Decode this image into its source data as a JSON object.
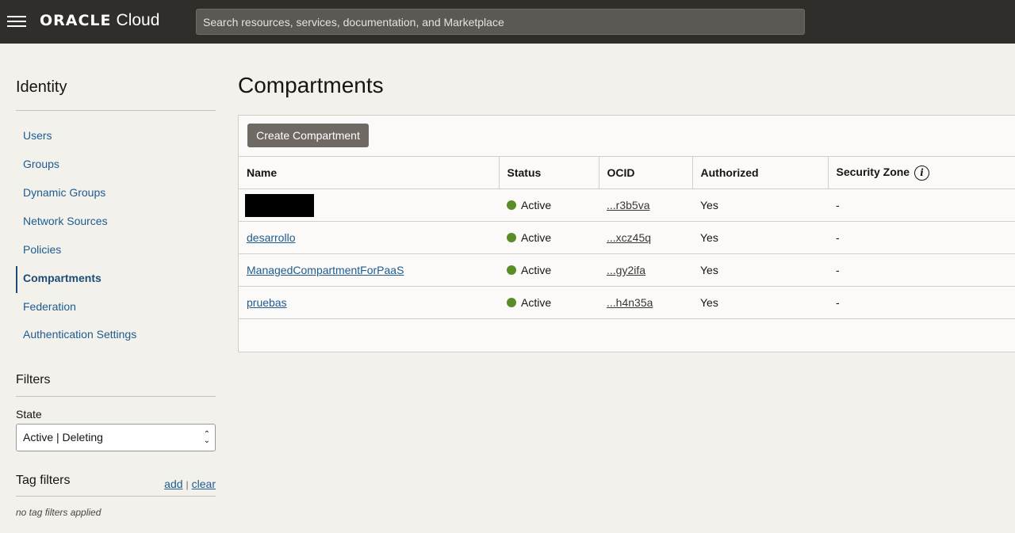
{
  "topbar": {
    "brand": "ORACLE",
    "product": "Cloud",
    "search_placeholder": "Search resources, services, documentation, and Marketplace"
  },
  "sidebar": {
    "title": "Identity",
    "items": [
      {
        "label": "Users"
      },
      {
        "label": "Groups"
      },
      {
        "label": "Dynamic Groups"
      },
      {
        "label": "Network Sources"
      },
      {
        "label": "Policies"
      },
      {
        "label": "Compartments",
        "active": true
      },
      {
        "label": "Federation"
      },
      {
        "label": "Authentication Settings"
      }
    ],
    "filters_title": "Filters",
    "state_label": "State",
    "state_value": "Active | Deleting",
    "tag_filters_title": "Tag filters",
    "tag_add": "add",
    "tag_sep": "|",
    "tag_clear": "clear",
    "no_tags": "no tag filters applied"
  },
  "main": {
    "title": "Compartments",
    "create_button": "Create Compartment",
    "columns": [
      "Name",
      "Status",
      "OCID",
      "Authorized",
      "Security Zone"
    ],
    "rows": [
      {
        "name": "",
        "redacted": true,
        "status": "Active",
        "ocid": "...r3b5va",
        "authorized": "Yes",
        "security_zone": "-"
      },
      {
        "name": "desarrollo",
        "status": "Active",
        "ocid": "...xcz45q",
        "authorized": "Yes",
        "security_zone": "-"
      },
      {
        "name": "ManagedCompartmentForPaaS",
        "status": "Active",
        "ocid": "...gy2ifa",
        "authorized": "Yes",
        "security_zone": "-"
      },
      {
        "name": "pruebas",
        "status": "Active",
        "ocid": "...h4n35a",
        "authorized": "Yes",
        "security_zone": "-"
      }
    ],
    "status_color": "#5b8c2a"
  }
}
